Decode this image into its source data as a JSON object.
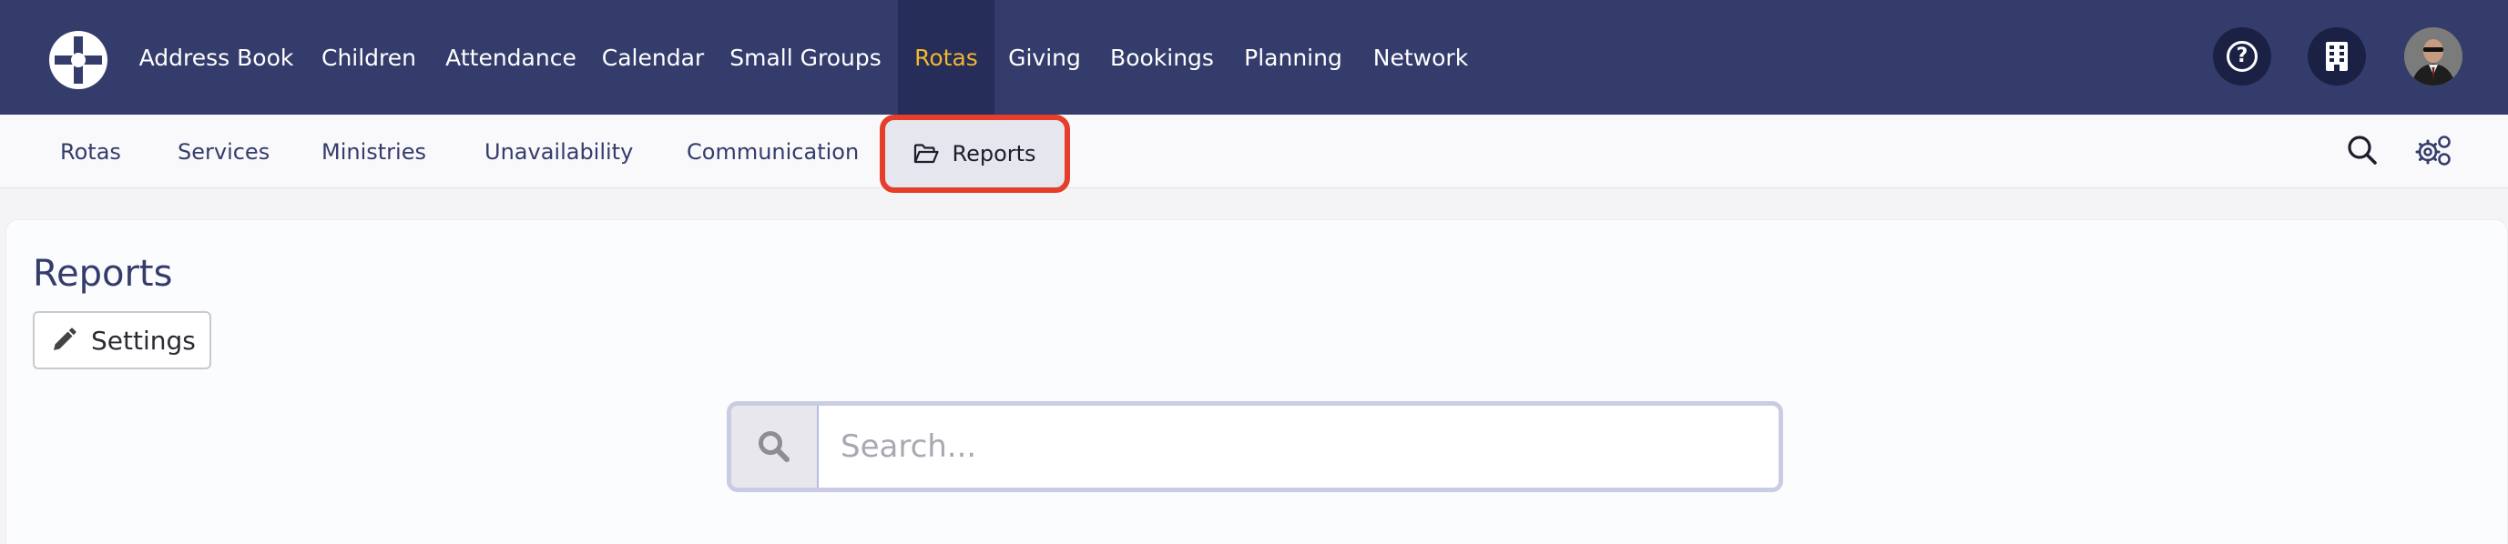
{
  "nav": {
    "items": [
      {
        "label": "Address Book"
      },
      {
        "label": "Children"
      },
      {
        "label": "Attendance"
      },
      {
        "label": "Calendar"
      },
      {
        "label": "Small Groups"
      },
      {
        "label": "Rotas",
        "active": true
      },
      {
        "label": "Giving"
      },
      {
        "label": "Bookings"
      },
      {
        "label": "Planning"
      },
      {
        "label": "Network"
      }
    ],
    "help_glyph": "?",
    "icons": [
      "help-icon",
      "organisation-icon",
      "user-avatar"
    ]
  },
  "subnav": {
    "items": [
      {
        "label": "Rotas"
      },
      {
        "label": "Services"
      },
      {
        "label": "Ministries"
      },
      {
        "label": "Unavailability"
      },
      {
        "label": "Communication"
      }
    ],
    "active_label": "Reports",
    "active_icon": "folder-open-icon",
    "right_icons": [
      "search-icon",
      "cogs-icon"
    ]
  },
  "page": {
    "title": "Reports",
    "settings_label": "Settings",
    "settings_icon": "pencil-icon"
  },
  "search": {
    "placeholder": "Search...",
    "value": "",
    "icon": "search-icon"
  },
  "colors": {
    "topbar": "#343c6c",
    "nav_active_bg": "#262d59",
    "nav_active_text": "#f0b72f",
    "highlight": "#e53e2a"
  }
}
